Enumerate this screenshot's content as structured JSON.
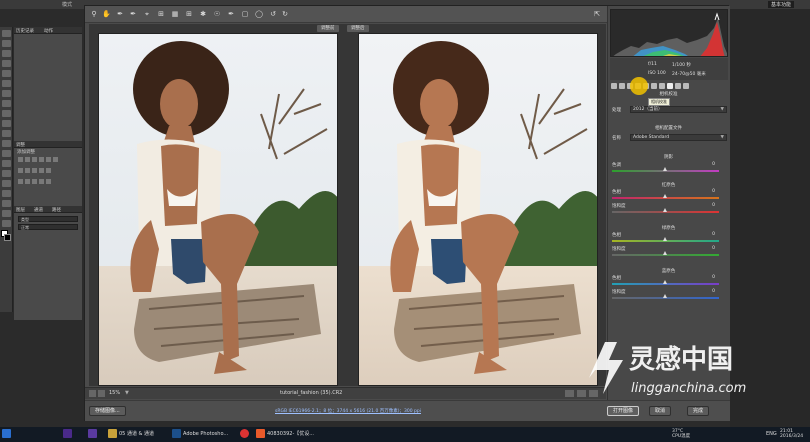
{
  "ps": {
    "menubar": {
      "mode_text": "模式",
      "basic_feature": "基本功能"
    },
    "left_panels": {
      "history_tabs": [
        "历史记录",
        "动作"
      ],
      "adjust_tab": "调整",
      "adjust_add": "添加调整",
      "layers_tabs": [
        "图层",
        "通道",
        "路径"
      ],
      "layer_kind": "类型",
      "blend_mode": "正常"
    }
  },
  "acr": {
    "view_labels": {
      "before": "调整前",
      "after": "调整后"
    },
    "camera_info": {
      "row1_left": "f/11",
      "row1_right": "1/100 秒",
      "row2_left": "ISO 100",
      "row2_right": "24-70@50 毫米"
    },
    "tooltip": "相机校准",
    "calibration": {
      "title": "相机校准",
      "process_label": "处理",
      "process_value": "2012（当前）",
      "profile_section": "相机配置文件",
      "profile_label": "名称",
      "profile_value": "Adobe Standard",
      "shadows_title": "阴影",
      "sliders_shadow": [
        {
          "label": "色调",
          "value": "0"
        }
      ],
      "red_title": "红原色",
      "sliders_red": [
        {
          "label": "色相",
          "value": "0"
        },
        {
          "label": "饱和度",
          "value": "0"
        }
      ],
      "green_title": "绿原色",
      "sliders_green": [
        {
          "label": "色相",
          "value": "0"
        },
        {
          "label": "饱和度",
          "value": "0"
        }
      ],
      "blue_title": "蓝原色",
      "sliders_blue": [
        {
          "label": "色相",
          "value": "0"
        },
        {
          "label": "饱和度",
          "value": "0"
        }
      ]
    },
    "status": {
      "zoom": "15%",
      "filename": "tutorial_fashion (35).CR2",
      "workflow": "sRGB IEC61966-2.1；8 位；3744 x 5616 (21.0 百万像素)；300 ppi"
    },
    "buttons": {
      "save": "存储图像...",
      "open": "打开图像",
      "cancel": "取消",
      "done": "完成"
    }
  },
  "taskbar": {
    "items": [
      {
        "label": "05 通道 & 通道"
      },
      {
        "label": "Adobe Photosho..."
      },
      {
        "label": "40830392-【优设..."
      }
    ],
    "temp": "37°C",
    "cpu": "CPU温度",
    "lang": "ENG",
    "time": "21:01",
    "date": "2016/3/24"
  },
  "watermark": {
    "cn": "灵感中国",
    "en": "lingganchina.com"
  },
  "colors": {
    "accent_yellow": "#f2c200",
    "red_track": "#d33",
    "green_track": "#3a3",
    "blue_track": "#36c"
  }
}
